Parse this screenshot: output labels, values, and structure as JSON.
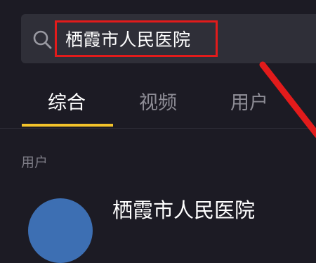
{
  "search": {
    "query": "栖霞市人民医院",
    "icon": "search-icon"
  },
  "tabs": [
    {
      "label": "综合",
      "active": true
    },
    {
      "label": "视频",
      "active": false
    },
    {
      "label": "用户",
      "active": false
    }
  ],
  "section": {
    "label": "用户"
  },
  "result": {
    "name": "栖霞市人民医院"
  },
  "colors": {
    "background": "#1c1b24",
    "search_bg": "#2f2f38",
    "highlight_red": "#e21b1b",
    "tab_indicator": "#f3c32a"
  }
}
